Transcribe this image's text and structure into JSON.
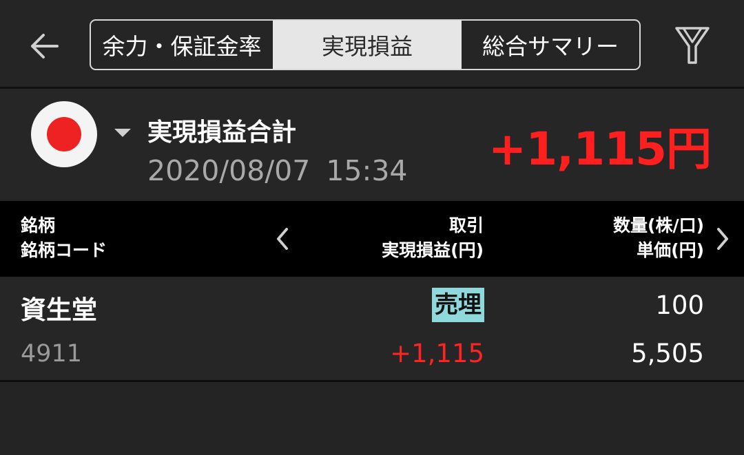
{
  "header": {
    "tabs": [
      {
        "label": "余力・保証金率",
        "selected": false
      },
      {
        "label": "実現損益",
        "selected": true
      },
      {
        "label": "総合サマリー",
        "selected": false
      }
    ],
    "back_icon": "arrow-left-icon",
    "filter_icon": "filter-icon"
  },
  "summary": {
    "market_flag": "japan-flag-icon",
    "title": "実現損益合計",
    "datetime": "2020/08/07 15:34",
    "total": "+1,115円"
  },
  "table": {
    "headers": {
      "name": [
        "銘柄",
        "銘柄コード"
      ],
      "trade": [
        "取引",
        "実現損益(円)"
      ],
      "quantity": [
        "数量(株/口)",
        "単価(円)"
      ]
    },
    "rows": [
      {
        "name": "資生堂",
        "code": "4911",
        "trade_type": "売埋",
        "realized_pnl": "+1,115",
        "quantity": "100",
        "unit_price": "5,505"
      }
    ]
  },
  "colors": {
    "background": "#242424",
    "profit_red": "#ff1f1f",
    "badge_cyan": "#8fd8db",
    "tab_selected": "#e6e6e6"
  }
}
